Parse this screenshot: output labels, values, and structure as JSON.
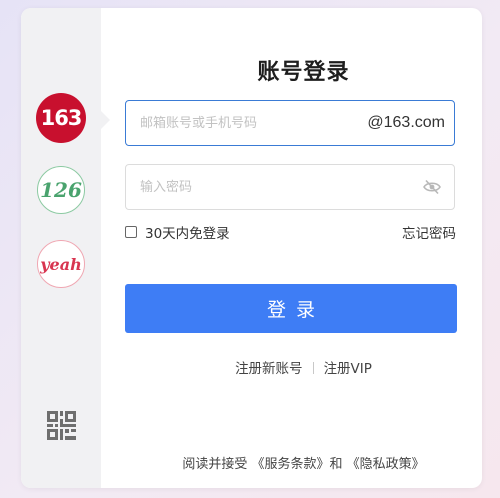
{
  "login": {
    "title": "账号登录",
    "email_placeholder": "邮箱账号或手机号码",
    "email_suffix": "@163.com",
    "password_placeholder": "输入密码",
    "remember_label": "30天内免登录",
    "forgot_label": "忘记密码",
    "submit_label": "登录",
    "register_label": "注册新账号",
    "vip_label": "注册VIP",
    "terms": {
      "prefix": "阅读并接受",
      "service": "《服务条款》",
      "and": "和",
      "privacy": "《隐私政策》"
    }
  },
  "providers": [
    {
      "label": "163",
      "selected": true
    },
    {
      "label": "126",
      "selected": false
    },
    {
      "label": "yeah",
      "selected": false
    }
  ],
  "colors": {
    "primary": "#3e7df5",
    "brand_163": "#c8102e",
    "brand_126": "#4aa36e",
    "brand_yeah": "#d83550",
    "focus_border": "#3a7bd5"
  },
  "icons": {
    "qr": "qr-code-icon",
    "password_toggle": "eye-slash-icon"
  }
}
